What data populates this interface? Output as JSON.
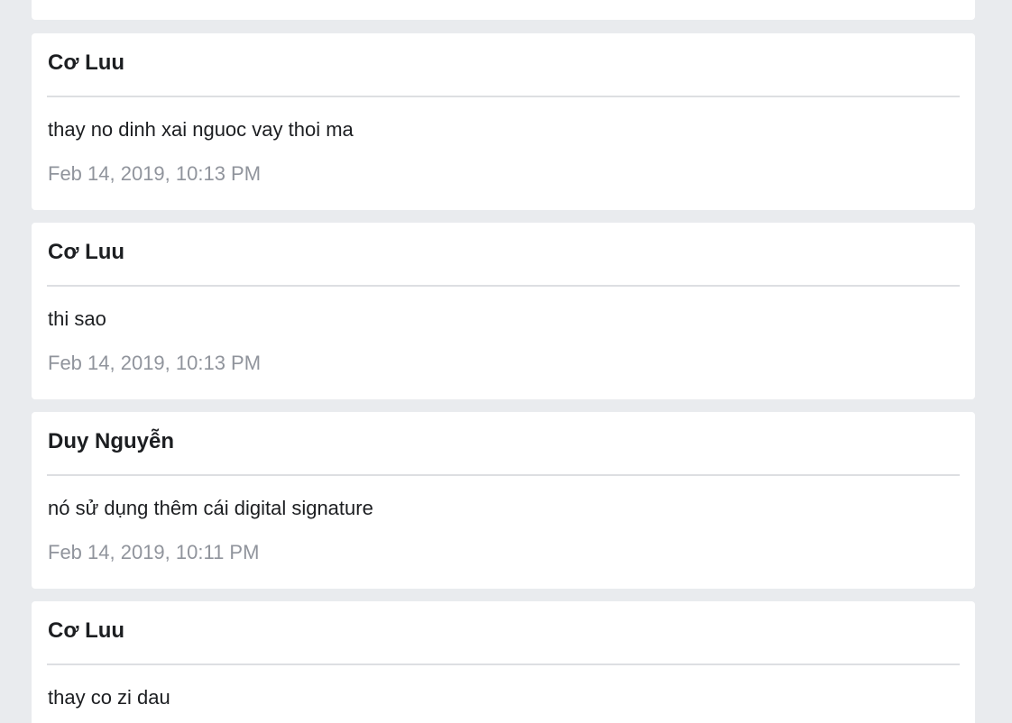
{
  "messages": [
    {
      "sender": "Cơ Luu",
      "text": "thay no dinh xai nguoc vay thoi ma",
      "timestamp": "Feb 14, 2019, 10:13 PM"
    },
    {
      "sender": "Cơ Luu",
      "text": "thi sao",
      "timestamp": "Feb 14, 2019, 10:13 PM"
    },
    {
      "sender": "Duy Nguyễn",
      "text": "nó sử dụng thêm cái digital signature",
      "timestamp": "Feb 14, 2019, 10:11 PM"
    },
    {
      "sender": "Cơ Luu",
      "text": "thay co zi dau",
      "timestamp": ""
    }
  ]
}
